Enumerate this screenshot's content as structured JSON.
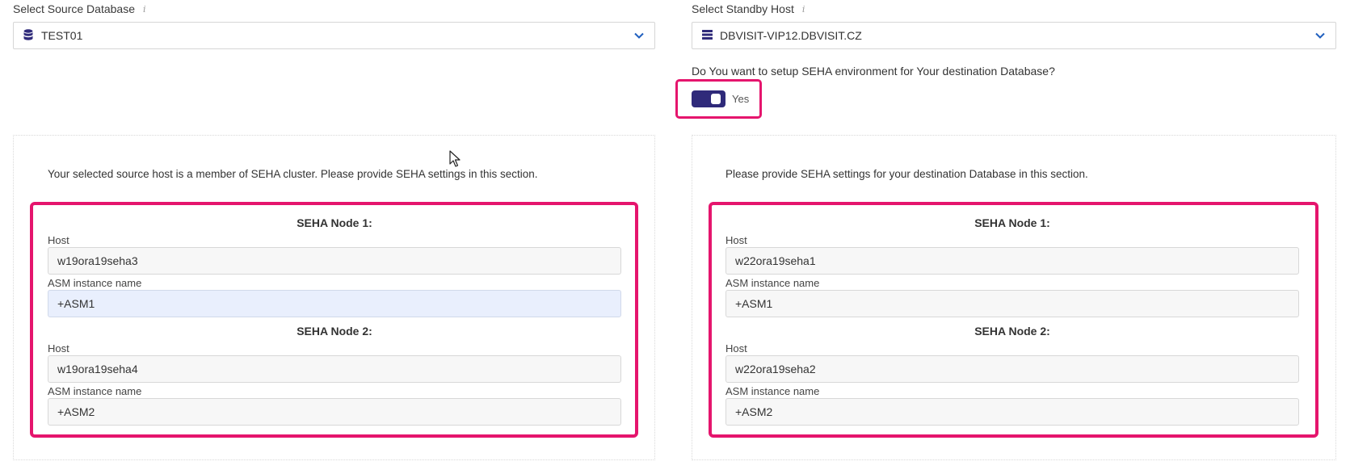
{
  "source": {
    "label": "Select Source Database",
    "info_icon": "info-icon",
    "selected": "TEST01",
    "icon": "database-icon"
  },
  "standby": {
    "label": "Select Standby Host",
    "info_icon": "info-icon",
    "selected": "DBVISIT-VIP12.DBVISIT.CZ",
    "icon": "server-icon"
  },
  "seha_question": {
    "text": "Do You want to setup SEHA environment for Your destination Database?",
    "toggle_value": "Yes",
    "toggle_on": true
  },
  "source_panel": {
    "description": "Your selected source host is a member of SEHA cluster. Please provide SEHA settings in this section.",
    "node1": {
      "title": "SEHA Node 1:",
      "host_label": "Host",
      "host_value": "w19ora19seha3",
      "asm_label": "ASM instance name",
      "asm_value": "+ASM1"
    },
    "node2": {
      "title": "SEHA Node 2:",
      "host_label": "Host",
      "host_value": "w19ora19seha4",
      "asm_label": "ASM instance name",
      "asm_value": "+ASM2"
    }
  },
  "dest_panel": {
    "description": "Please provide SEHA settings for your destination Database in this section.",
    "node1": {
      "title": "SEHA Node 1:",
      "host_label": "Host",
      "host_value": "w22ora19seha1",
      "asm_label": "ASM instance name",
      "asm_value": "+ASM1"
    },
    "node2": {
      "title": "SEHA Node 2:",
      "host_label": "Host",
      "host_value": "w22ora19seha2",
      "asm_label": "ASM instance name",
      "asm_value": "+ASM2"
    }
  },
  "colors": {
    "highlight": "#e5156d",
    "toggle": "#2f2a7a",
    "chevron": "#1f5fbf"
  }
}
